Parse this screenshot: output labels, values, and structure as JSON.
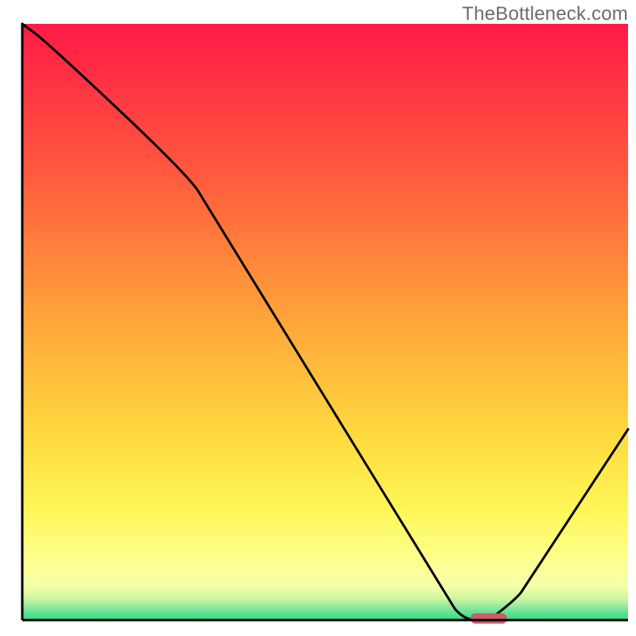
{
  "watermark": "TheBottleneck.com",
  "chart_data": {
    "type": "line",
    "title": "",
    "xlabel": "",
    "ylabel": "",
    "xlim": [
      0,
      100
    ],
    "ylim": [
      0,
      100
    ],
    "x": [
      0,
      4,
      27,
      73,
      77,
      81,
      100
    ],
    "values": [
      100,
      97,
      75,
      0,
      0,
      3,
      32
    ],
    "marker": {
      "x_start": 74,
      "x_end": 80,
      "y": 0,
      "color": "#d05a66"
    },
    "background": {
      "type": "vertical-gradient",
      "stops": [
        {
          "pos": 0.0,
          "color": "#ff1a47"
        },
        {
          "pos": 0.26,
          "color": "#ff5c3d"
        },
        {
          "pos": 0.5,
          "color": "#ffa63a"
        },
        {
          "pos": 0.7,
          "color": "#ffdc3f"
        },
        {
          "pos": 0.82,
          "color": "#fff75a"
        },
        {
          "pos": 0.9,
          "color": "#fdff8f"
        },
        {
          "pos": 0.945,
          "color": "#f4ffa8"
        },
        {
          "pos": 0.965,
          "color": "#c9f5a0"
        },
        {
          "pos": 0.982,
          "color": "#7be59d"
        },
        {
          "pos": 1.0,
          "color": "#2fd985"
        }
      ]
    },
    "axis_color": "#000000"
  }
}
